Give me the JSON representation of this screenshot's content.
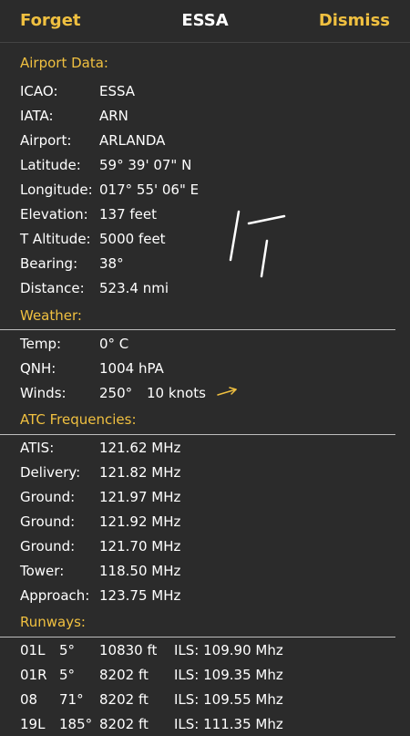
{
  "nav": {
    "left": "Forget",
    "title": "ESSA",
    "right": "Dismiss"
  },
  "airport": {
    "title": "Airport Data:",
    "rows": [
      {
        "label": "ICAO:",
        "value": "ESSA"
      },
      {
        "label": "IATA:",
        "value": "ARN"
      },
      {
        "label": "Airport:",
        "value": "ARLANDA"
      },
      {
        "label": "Latitude:",
        "value": "59° 39' 07\" N"
      },
      {
        "label": "Longitude:",
        "value": "017° 55' 06\" E"
      },
      {
        "label": "Elevation:",
        "value": "137 feet"
      },
      {
        "label": "T Altitude:",
        "value": "5000 feet"
      },
      {
        "label": "Bearing:",
        "value": "38°"
      },
      {
        "label": "Distance:",
        "value": "523.4 nmi"
      }
    ]
  },
  "weather": {
    "title": "Weather:",
    "temp": {
      "label": "Temp:",
      "value": "0° C"
    },
    "qnh": {
      "label": "QNH:",
      "value": "1004 hPA"
    },
    "winds": {
      "label": "Winds:",
      "direction": "250°",
      "speed": "10 knots"
    }
  },
  "atc": {
    "title": "ATC Frequencies:",
    "rows": [
      {
        "label": "ATIS:",
        "value": "121.62 MHz"
      },
      {
        "label": "Delivery:",
        "value": "121.82 MHz"
      },
      {
        "label": "Ground:",
        "value": "121.97 MHz"
      },
      {
        "label": "Ground:",
        "value": "121.92 MHz"
      },
      {
        "label": "Ground:",
        "value": "121.70 MHz"
      },
      {
        "label": "Tower:",
        "value": "118.50 MHz"
      },
      {
        "label": "Approach:",
        "value": "123.75 MHz"
      }
    ]
  },
  "runways": {
    "title": "Runways:",
    "rows": [
      {
        "id": "01L",
        "heading": "5°",
        "length": "10830 ft",
        "ils": "ILS: 109.90 Mhz"
      },
      {
        "id": "01R",
        "heading": "5°",
        "length": "8202 ft",
        "ils": "ILS: 109.35 Mhz"
      },
      {
        "id": "08",
        "heading": "71°",
        "length": "8202 ft",
        "ils": "ILS: 109.55 Mhz"
      },
      {
        "id": "19L",
        "heading": "185°",
        "length": "8202 ft",
        "ils": "ILS: 111.35 Mhz"
      }
    ]
  },
  "colors": {
    "accent": "#f0c040",
    "background": "#2b2b2b",
    "divider": "#bdbdbd"
  },
  "icons": {
    "wind": "wind-arrow-icon",
    "runway_diagram": "runway-diagram-icon"
  }
}
